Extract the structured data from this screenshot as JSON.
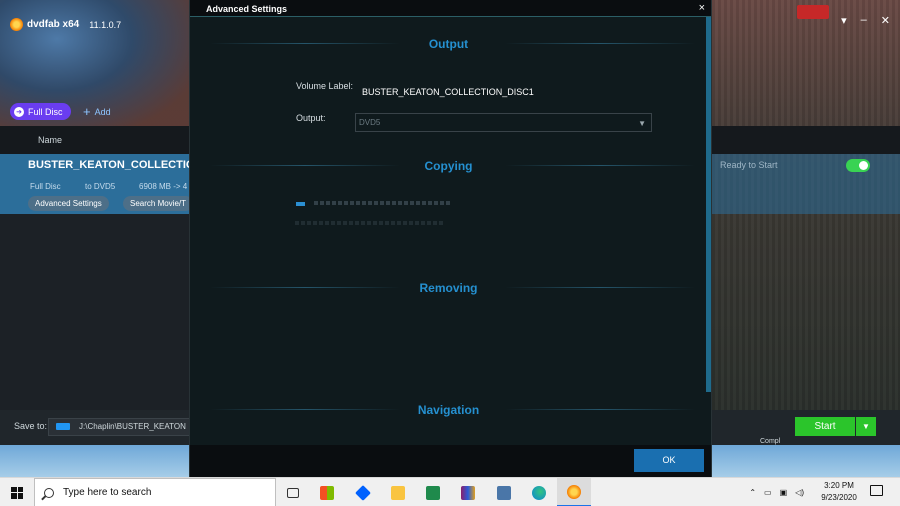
{
  "app": {
    "logo_text": "dvdfab x64",
    "version": "11.1.0.7",
    "full_disc_label": "Full Disc",
    "add_label": "Add",
    "column_name": "Name",
    "task": {
      "title": "BUSTER_KEATON_COLLECTION",
      "mode": "Full Disc",
      "target": "to DVD5",
      "size": "6908 MB -> 4",
      "status": "Ready to Start",
      "advanced_settings_label": "Advanced Settings",
      "search_label": "Search Movie/T"
    },
    "save_to_label": "Save to:",
    "save_to_path": "J:\\Chaplin\\BUSTER_KEATON",
    "start_label": "Start",
    "right_tiny_text": "Compl"
  },
  "dialog": {
    "title": "Advanced Settings",
    "close_glyph": "×",
    "sections": {
      "output": "Output",
      "copying": "Copying",
      "removing": "Removing",
      "navigation": "Navigation"
    },
    "volume_label_label": "Volume Label:",
    "volume_label_value": "BUSTER_KEATON_COLLECTION_DISC1",
    "output_label": "Output:",
    "output_value": "DVD5",
    "ok_label": "OK"
  },
  "taskbar": {
    "search_placeholder": "Type here to search",
    "time": "3:20 PM",
    "date": "9/23/2020",
    "icons": [
      "task-view-icon",
      "store-icon",
      "dropbox-icon",
      "file-explorer-icon",
      "excel-icon",
      "winrar-icon",
      "vk-icon",
      "edge-icon",
      "dvdfab-icon"
    ]
  },
  "colors": {
    "accent": "#2590d0",
    "start_green": "#2bc52b",
    "full_disc_purple": "#6a3df0",
    "ok_blue": "#1a6fb0"
  }
}
